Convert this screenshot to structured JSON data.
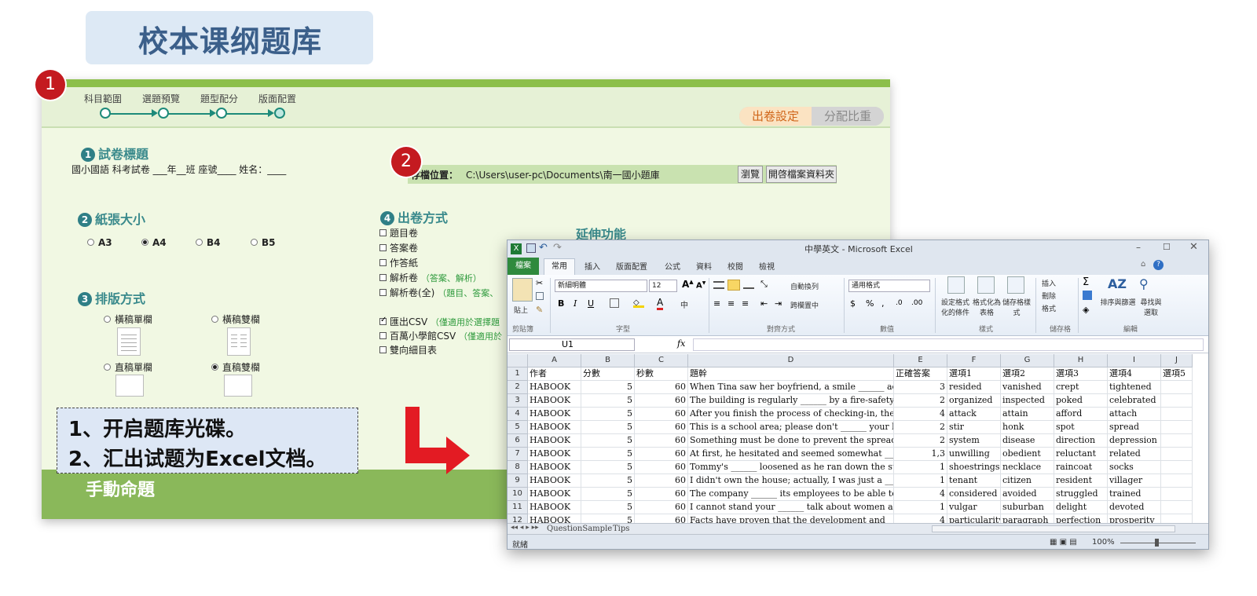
{
  "title": "校本课纲题库",
  "badges": {
    "one": "1",
    "two": "2"
  },
  "app": {
    "steps": [
      "科目範圍",
      "選題預覽",
      "題型配分",
      "版面配置"
    ],
    "tabs": {
      "active": "出卷設定",
      "inactive": "分配比重"
    },
    "section1": {
      "num": "1",
      "title": "試卷標題",
      "value": "國小國語 科考試卷 ___年__班 座號____ 姓名：____"
    },
    "section2": {
      "num": "2",
      "title": "紙張大小",
      "options": [
        "A3",
        "A4",
        "B4",
        "B5"
      ],
      "selected": "A4"
    },
    "section3": {
      "num": "3",
      "title": "排版方式",
      "options": [
        "橫稿單欄",
        "橫稿雙欄",
        "直稿單欄",
        "直稿雙欄"
      ],
      "selected": "直稿雙欄"
    },
    "save": {
      "label": "存檔位置：",
      "path": "C:\\Users\\user-pc\\Documents\\南一國小題庫",
      "browse": "瀏覽",
      "open_folder": "開啓檔案資料夾"
    },
    "section4": {
      "num": "4",
      "title": "出卷方式",
      "items": [
        {
          "label": "題目卷",
          "hint": "",
          "checked": false
        },
        {
          "label": "答案卷",
          "hint": "",
          "checked": false
        },
        {
          "label": "作答紙",
          "hint": "",
          "checked": false
        },
        {
          "label": "解析卷",
          "hint": "（答案、解析）",
          "checked": false
        },
        {
          "label": "解析卷(全)",
          "hint": "（題目、答案、",
          "checked": false
        }
      ],
      "export_items": [
        {
          "label": "匯出CSV",
          "hint": "（僅適用於選擇題",
          "checked": true
        },
        {
          "label": "百萬小學館CSV",
          "hint": "（僅適用於",
          "checked": false
        },
        {
          "label": "雙向細目表",
          "hint": "",
          "checked": false
        }
      ]
    },
    "extend_title": "延伸功能",
    "bottom_label": "手動命題"
  },
  "annotation": {
    "line1": "1、开启题库光碟。",
    "line2": "2、汇出试题为Excel文档。"
  },
  "excel": {
    "window_title": "中學英文 - Microsoft Excel",
    "tabs": [
      "檔案",
      "常用",
      "插入",
      "版面配置",
      "公式",
      "資料",
      "校閱",
      "檢視"
    ],
    "ribbon": {
      "font_name": "新細明體",
      "font_size": "12",
      "number_format": "通用格式",
      "group_labels": [
        "剪貼簿",
        "字型",
        "對齊方式",
        "數值",
        "樣式",
        "儲存格",
        "編輯"
      ],
      "paste": "貼上",
      "wrap": "自動換列",
      "merge": "跨欄置中",
      "insert": "插入",
      "delete": "刪除",
      "format": "格式",
      "cond_format": "設定格式化的條件",
      "table_format": "格式化為表格",
      "cell_style": "儲存格樣式",
      "sort": "排序與篩選",
      "find": "尋找與選取"
    },
    "name_box": "U1",
    "fx": "fx",
    "columns": [
      "A",
      "B",
      "C",
      "D",
      "E",
      "F",
      "G",
      "H",
      "I",
      "J"
    ],
    "rows": [
      [
        "作者",
        "分數",
        "秒數",
        "題幹",
        "正確答案",
        "選項1",
        "選項2",
        "選項3",
        "選項4",
        "選項5"
      ],
      [
        "HABOOK",
        "5",
        "60",
        "When Tina saw her boyfriend, a smile ______ across",
        "3",
        "resided",
        "vanished",
        "crept",
        "tightened",
        ""
      ],
      [
        "HABOOK",
        "5",
        "60",
        "The building is regularly ______ by a fire-safety offic",
        "2",
        "organized",
        "inspected",
        "poked",
        "celebrated",
        ""
      ],
      [
        "HABOOK",
        "5",
        "60",
        "After you finish the process of checking-in, the clerk",
        "4",
        "attack",
        "attain",
        "afford",
        "attach",
        ""
      ],
      [
        "HABOOK",
        "5",
        "60",
        "This is a school area; please don't ______ your horn w",
        "2",
        "stir",
        "honk",
        "spot",
        "spread",
        ""
      ],
      [
        "HABOOK",
        "5",
        "60",
        "Something must be done to prevent the spread of mad",
        "2",
        "system",
        "disease",
        "direction",
        "depression",
        ""
      ],
      [
        "HABOOK",
        "5",
        "60",
        "At first, he hesitated and seemed somewhat ______ to",
        "1,3",
        "unwilling",
        "obedient",
        "reluctant",
        "related",
        ""
      ],
      [
        "HABOOK",
        "5",
        "60",
        "Tommy's ______ loosened as he ran down the street.",
        "1",
        "shoestrings",
        "necklace",
        "raincoat",
        "socks",
        ""
      ],
      [
        "HABOOK",
        "5",
        "60",
        "I didn't own the house; actually, I was just a ______ t",
        "1",
        "tenant",
        "citizen",
        "resident",
        "villager",
        ""
      ],
      [
        "HABOOK",
        "5",
        "60",
        "The company ______ its employees to be able to dea",
        "4",
        "considered",
        "avoided",
        "struggled",
        "trained",
        ""
      ],
      [
        "HABOOK",
        "5",
        "60",
        "I cannot stand your ______ talk about women any mo",
        "1",
        "vulgar",
        "suburban",
        "delight",
        "devoted",
        ""
      ],
      [
        "HABOOK",
        "5",
        "60",
        "Facts have proven that the development and",
        "4",
        "particularity",
        "paragraph",
        "perfection",
        "prosperity",
        ""
      ]
    ],
    "sheets": [
      "QuestionSample",
      "Tips"
    ],
    "status": "就緒",
    "zoom": "100%"
  }
}
